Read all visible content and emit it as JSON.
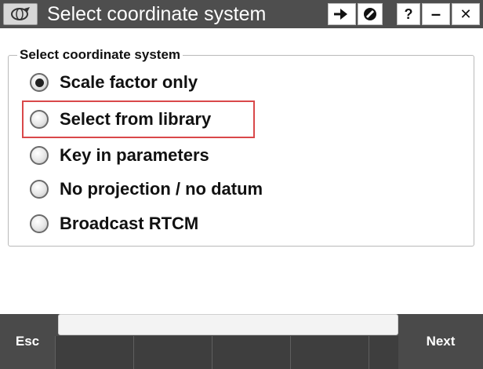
{
  "window": {
    "title": "Select coordinate system",
    "icons": {
      "app": "trimble-app-icon",
      "continue": "arrow-right-icon",
      "no_entry": "no-entry-icon",
      "help": "help-icon",
      "minimize": "minimize-icon",
      "close": "close-icon"
    },
    "help_label": "?",
    "minimize_label": "–",
    "close_label": "✕"
  },
  "group": {
    "legend": "Select coordinate system",
    "options": [
      {
        "label": "Scale factor only",
        "selected": true
      },
      {
        "label": "Select from library",
        "selected": false,
        "highlighted": true
      },
      {
        "label": "Key in parameters",
        "selected": false
      },
      {
        "label": "No projection / no datum",
        "selected": false
      },
      {
        "label": "Broadcast RTCM",
        "selected": false
      }
    ]
  },
  "bottom": {
    "esc_label": "Esc",
    "next_label": "Next",
    "status_text": ""
  },
  "colors": {
    "titlebar": "#4e4e4e",
    "bottombar": "#4a4a4a",
    "highlight": "#d9484a"
  }
}
